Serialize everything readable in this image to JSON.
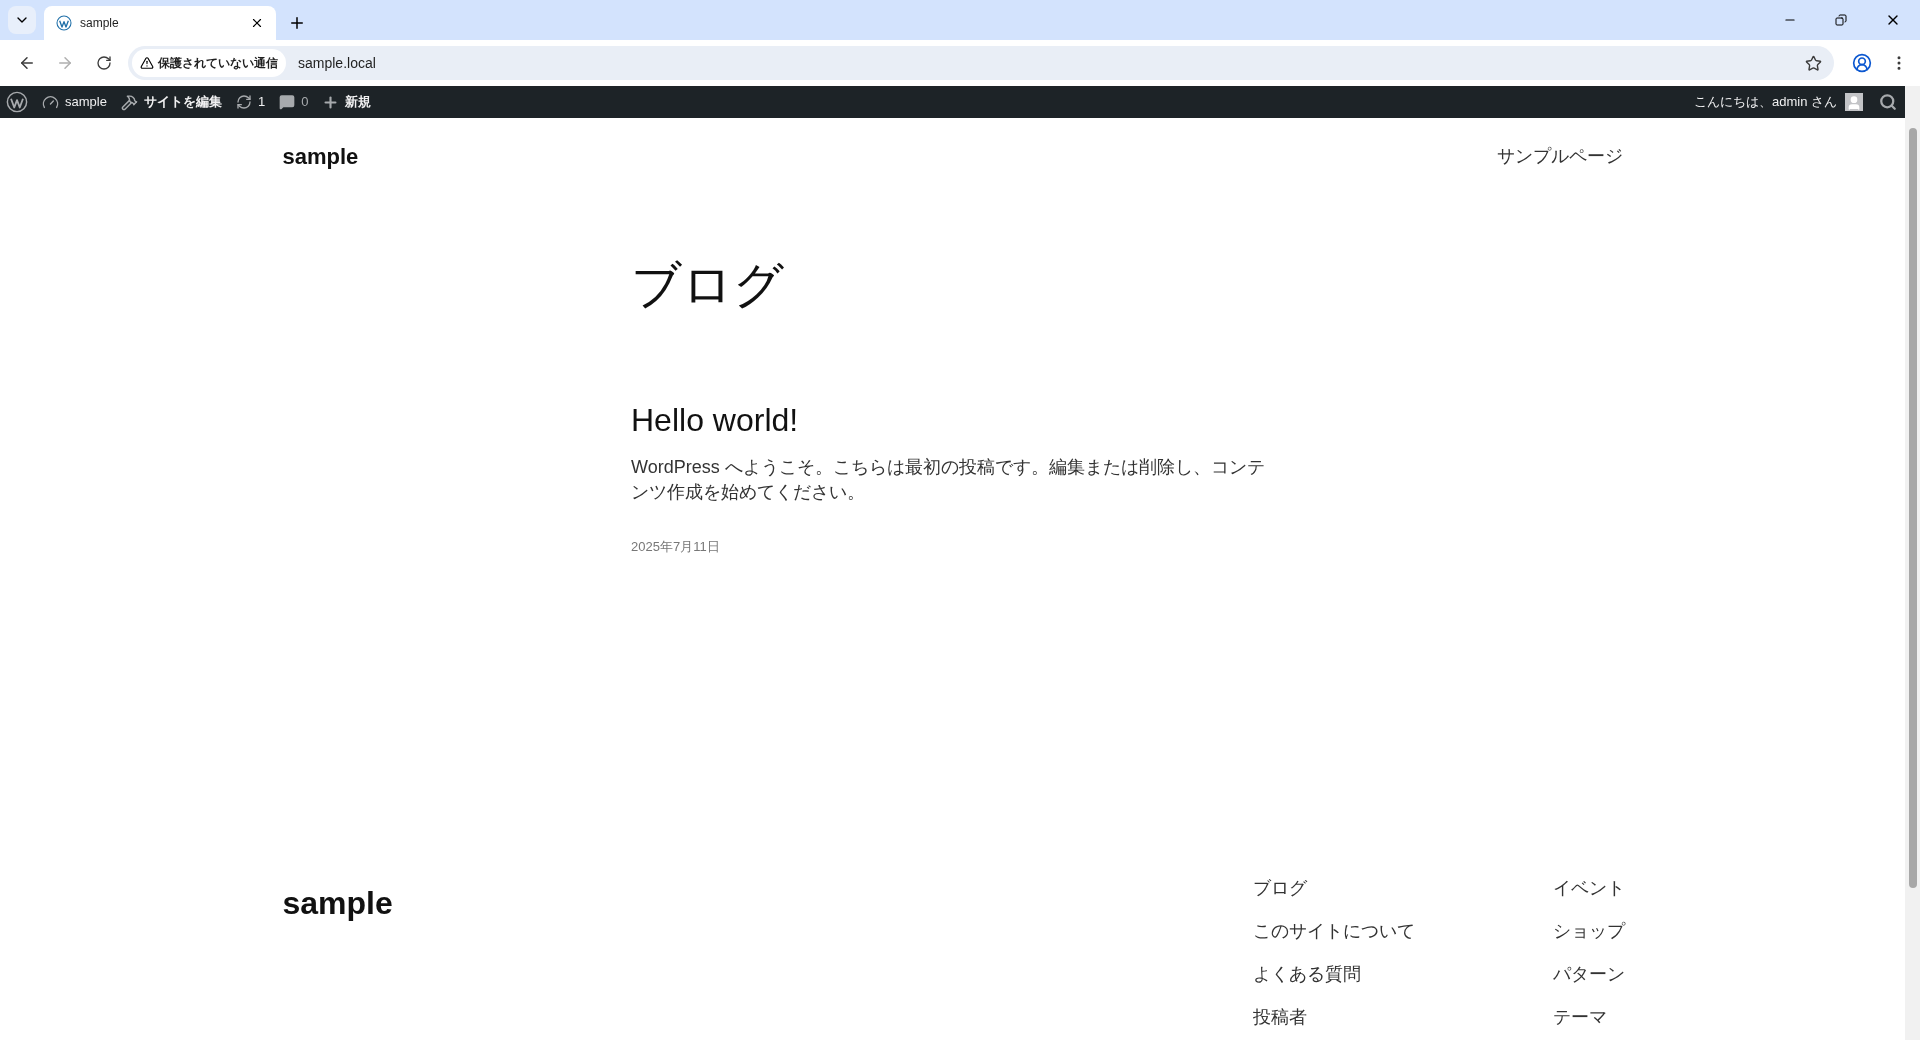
{
  "browser": {
    "tab": {
      "title": "sample",
      "selected": true
    },
    "security_label": "保護されていない通信",
    "url": "sample.local"
  },
  "admin_bar": {
    "site": "sample",
    "edit_site": "サイトを編集",
    "updates": "1",
    "comments": "0",
    "new": "新規",
    "greeting": "こんにちは、admin さん"
  },
  "header": {
    "site_title": "sample",
    "nav": [
      "サンプルページ"
    ]
  },
  "main": {
    "title": "ブログ",
    "posts": [
      {
        "title": "Hello world!",
        "excerpt": "WordPress へようこそ。こちらは最初の投稿です。編集または削除し、コンテンツ作成を始めてください。",
        "date": "2025年7月11日"
      }
    ]
  },
  "footer": {
    "site_title": "sample",
    "columns": [
      [
        "ブログ",
        "このサイトについて",
        "よくある質問",
        "投稿者"
      ],
      [
        "イベント",
        "ショップ",
        "パターン",
        "テーマ"
      ]
    ]
  }
}
